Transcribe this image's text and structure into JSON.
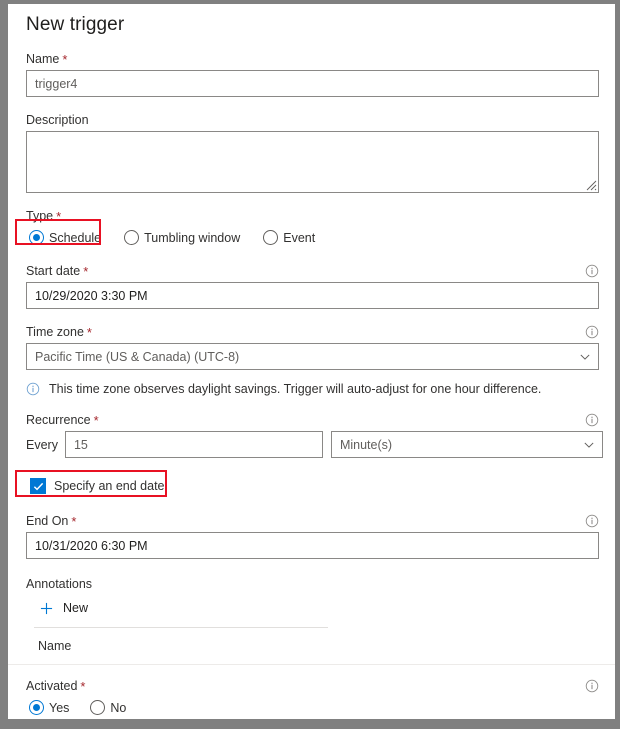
{
  "window": {
    "title": "New trigger",
    "frame_color": "#808080",
    "panel_bg": "#ffffff",
    "highlight_color": "#e81123",
    "accent_color": "#0078d4",
    "required_color": "#a4262c"
  },
  "fields": {
    "name": {
      "label": "Name",
      "required_marker": "*",
      "value": "trigger4"
    },
    "description": {
      "label": "Description",
      "value": "",
      "placeholder": ""
    },
    "type": {
      "label": "Type",
      "required_marker": "*",
      "options": [
        {
          "label": "Schedule",
          "selected": true,
          "highlighted": true
        },
        {
          "label": "Tumbling window",
          "selected": false,
          "highlighted": false
        },
        {
          "label": "Event",
          "selected": false,
          "highlighted": false
        }
      ]
    },
    "start_date": {
      "label": "Start date",
      "required_marker": "*",
      "value": "10/29/2020 3:30 PM",
      "info_icon": "info-icon"
    },
    "time_zone": {
      "label": "Time zone",
      "required_marker": "*",
      "value": "Pacific Time (US & Canada) (UTC-8)",
      "info_icon": "info-icon",
      "chevron": "chevron-down-icon"
    },
    "time_zone_message": {
      "icon": "info-icon",
      "text": "This time zone observes daylight savings. Trigger will auto-adjust for one hour difference."
    },
    "recurrence": {
      "label": "Recurrence",
      "required_marker": "*",
      "info_icon": "info-icon",
      "every_label": "Every",
      "interval_value": "15",
      "unit_value": "Minute(s)"
    },
    "specify_end_date": {
      "label": "Specify an end date",
      "checked": true,
      "highlighted": true
    },
    "end_on": {
      "label": "End On",
      "required_marker": "*",
      "value": "10/31/2020 6:30 PM",
      "info_icon": "info-icon"
    },
    "annotations": {
      "label": "Annotations",
      "new_button_label": "New",
      "new_button_icon": "plus-icon",
      "table_columns": [
        "Name"
      ],
      "rows": []
    },
    "activated": {
      "label": "Activated",
      "required_marker": "*",
      "info_icon": "info-icon",
      "options": [
        {
          "label": "Yes",
          "selected": true
        },
        {
          "label": "No",
          "selected": false
        }
      ]
    }
  }
}
